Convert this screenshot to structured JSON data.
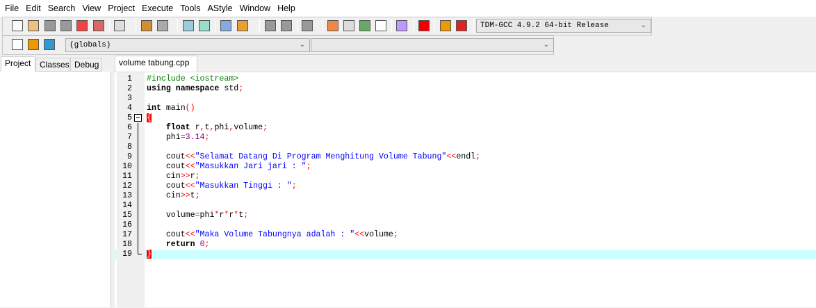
{
  "menu": [
    "File",
    "Edit",
    "Search",
    "View",
    "Project",
    "Execute",
    "Tools",
    "AStyle",
    "Window",
    "Help"
  ],
  "toolbar": {
    "icons_row1": [
      "new-file",
      "open-file",
      "save",
      "save-all",
      "close",
      "close-all",
      "print",
      "undo",
      "redo",
      "find",
      "replace",
      "indent",
      "unindent",
      "bookmark-toggle",
      "bookmark-goto",
      "comment",
      "grid-layout",
      "window",
      "tile",
      "cascade",
      "check-syntax",
      "stop",
      "profile",
      "delete-profile"
    ],
    "icons_row2": [
      "new-project",
      "add-to-project",
      "project-options"
    ],
    "compiler": "TDM-GCC 4.9.2 64-bit Release",
    "scope": "(globals)",
    "function": ""
  },
  "left_tabs": [
    "Project",
    "Classes",
    "Debug"
  ],
  "editor_tab": "volume tabung.cpp",
  "code": [
    [
      [
        "#include <iostream>",
        "p"
      ]
    ],
    [
      [
        "using",
        "k"
      ],
      [
        " "
      ],
      [
        "namespace",
        "k"
      ],
      [
        " std"
      ],
      [
        ";",
        "o"
      ]
    ],
    [],
    [
      [
        "int",
        "k"
      ],
      [
        " main"
      ],
      [
        "()",
        "o"
      ]
    ],
    [
      [
        "{",
        "b"
      ]
    ],
    [
      [
        "    "
      ],
      [
        "float",
        "k"
      ],
      [
        " r"
      ],
      [
        ",",
        "o"
      ],
      [
        "t"
      ],
      [
        ",",
        "o"
      ],
      [
        "phi"
      ],
      [
        ",",
        "o"
      ],
      [
        "volume"
      ],
      [
        ";",
        "o"
      ]
    ],
    [
      [
        "    phi"
      ],
      [
        "=",
        "o"
      ],
      [
        "3.14",
        "n"
      ],
      [
        ";",
        "o"
      ]
    ],
    [],
    [
      [
        "    cout"
      ],
      [
        "<<",
        "o"
      ],
      [
        "\"Selamat Datang Di Program Menghitung Volume Tabung\"",
        "s"
      ],
      [
        "<<",
        "o"
      ],
      [
        "endl"
      ],
      [
        ";",
        "o"
      ]
    ],
    [
      [
        "    cout"
      ],
      [
        "<<",
        "o"
      ],
      [
        "\"Masukkan Jari jari : \"",
        "s"
      ],
      [
        ";",
        "o"
      ]
    ],
    [
      [
        "    cin"
      ],
      [
        ">>",
        "o"
      ],
      [
        "r"
      ],
      [
        ";",
        "o"
      ]
    ],
    [
      [
        "    cout"
      ],
      [
        "<<",
        "o"
      ],
      [
        "\"Masukkan Tinggi : \"",
        "s"
      ],
      [
        ";",
        "o"
      ]
    ],
    [
      [
        "    cin"
      ],
      [
        ">>",
        "o"
      ],
      [
        "t"
      ],
      [
        ";",
        "o"
      ]
    ],
    [],
    [
      [
        "    volume"
      ],
      [
        "=",
        "o"
      ],
      [
        "phi"
      ],
      [
        "*",
        "o"
      ],
      [
        "r"
      ],
      [
        "*",
        "o"
      ],
      [
        "r"
      ],
      [
        "*",
        "o"
      ],
      [
        "t"
      ],
      [
        ";",
        "o"
      ]
    ],
    [],
    [
      [
        "    cout"
      ],
      [
        "<<",
        "o"
      ],
      [
        "\"Maka Volume Tabungnya adalah : \"",
        "s"
      ],
      [
        "<<",
        "o"
      ],
      [
        "volume"
      ],
      [
        ";",
        "o"
      ]
    ],
    [
      [
        "    "
      ],
      [
        "return",
        "k"
      ],
      [
        " "
      ],
      [
        "0",
        "n"
      ],
      [
        ";",
        "o"
      ]
    ],
    [
      [
        "}",
        "b"
      ]
    ]
  ],
  "current_line": 19,
  "colors": {
    "highlight": "#ccffff",
    "string": "#0000ff",
    "operator": "#ff0000",
    "preprocessor": "#008000",
    "number": "#800080"
  }
}
